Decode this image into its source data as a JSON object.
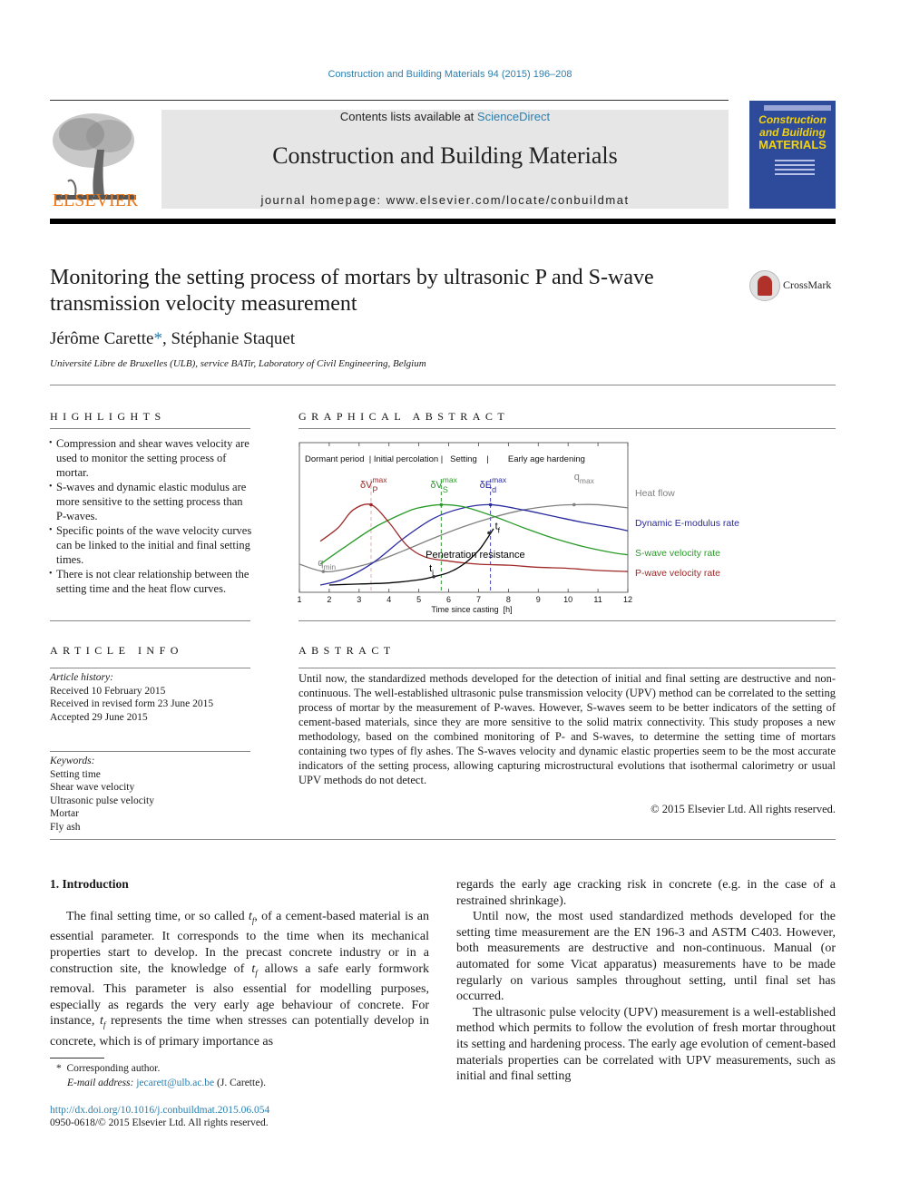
{
  "header": {
    "journal_reference": "Construction and Building Materials 94 (2015) 196–208",
    "contents_prefix": "Contents lists available at ",
    "contents_link": "ScienceDirect",
    "journal_title": "Construction and Building Materials",
    "homepage": "journal homepage: www.elsevier.com/locate/conbuildmat",
    "publisher_logo_text": "ELSEVIER",
    "cover": {
      "line1": "Construction",
      "line2": "and Building",
      "line3": "MATERIALS"
    }
  },
  "article": {
    "title": "Monitoring the setting process of mortars by ultrasonic P and S-wave transmission velocity measurement",
    "crossmark_label": "CrossMark",
    "authors": [
      {
        "name": "Jérôme Carette",
        "mark": "*"
      },
      {
        "name": "Stéphanie Staquet",
        "mark": ""
      }
    ],
    "author_separator": ", ",
    "affiliation": "Université Libre de Bruxelles (ULB), service BATir, Laboratory of Civil Engineering, Belgium"
  },
  "highlights": {
    "heading": "HIGHLIGHTS",
    "items": [
      "Compression and shear waves velocity are used to monitor the setting process of mortar.",
      "S-waves and dynamic elastic modulus are more sensitive to the setting process than P-waves.",
      "Specific points of the wave velocity curves can be linked to the initial and final setting times.",
      "There is not clear relationship between the setting time and the heat flow curves."
    ]
  },
  "graphical_abstract": {
    "heading": "GRAPHICAL ABSTRACT"
  },
  "article_info": {
    "heading": "ARTICLE INFO",
    "history_label": "Article history:",
    "history": [
      "Received 10 February 2015",
      "Received in revised form 23 June 2015",
      "Accepted 29 June 2015"
    ],
    "keywords_label": "Keywords:",
    "keywords": [
      "Setting time",
      "Shear wave velocity",
      "Ultrasonic pulse velocity",
      "Mortar",
      "Fly ash"
    ]
  },
  "abstract": {
    "heading": "ABSTRACT",
    "text": "Until now, the standardized methods developed for the detection of initial and final setting are destructive and non-continuous. The well-established ultrasonic pulse transmission velocity (UPV) method can be correlated to the setting process of mortar by the measurement of P-waves. However, S-waves seem to be better indicators of the setting of cement-based materials, since they are more sensitive to the solid matrix connectivity. This study proposes a new methodology, based on the combined monitoring of P- and S-waves, to determine the setting time of mortars containing two types of fly ashes. The S-waves velocity and dynamic elastic properties seem to be the most accurate indicators of the setting process, allowing capturing microstructural evolutions that isothermal calorimetry or usual UPV methods do not detect.",
    "copyright": "© 2015 Elsevier Ltd. All rights reserved."
  },
  "introduction": {
    "heading": "1. Introduction",
    "col1_p1_parts": [
      "The final setting time, or so called ",
      "t",
      "f",
      ", of a cement-based material is an essential parameter. It corresponds to the time when its mechanical properties start to develop. In the precast concrete industry or in a construction site, the knowledge of ",
      "t",
      "f",
      " allows a safe early formwork removal. This parameter is also essential for modelling purposes, especially as regards the very early age behaviour of concrete. For instance, ",
      "t",
      "f",
      " represents the time when stresses can potentially develop in concrete, which is of primary importance as"
    ],
    "col2_p0": "regards the early age cracking risk in concrete (e.g. in the case of a restrained shrinkage).",
    "col2_p1": "Until now, the most used standardized methods developed for the setting time measurement are the EN 196-3 and ASTM C403. However, both measurements are destructive and non-continuous. Manual (or automated for some Vicat apparatus) measurements have to be made regularly on various samples throughout setting, until final set has occurred.",
    "col2_p2": "The ultrasonic pulse velocity (UPV) measurement is a well-established method which permits to follow the evolution of fresh mortar throughout its setting and hardening process. The early age evolution of cement-based materials properties can be correlated with UPV measurements, such as initial and final setting"
  },
  "footnotes": {
    "corresponding_mark": "*",
    "corresponding": "Corresponding author.",
    "email_label": "E-mail address: ",
    "email": "jecarett@ulb.ac.be",
    "email_suffix": " (J. Carette).",
    "doi": "http://dx.doi.org/10.1016/j.conbuildmat.2015.06.054",
    "issn_line": "0950-0618/© 2015 Elsevier Ltd. All rights reserved."
  },
  "chart_data": {
    "type": "line",
    "title": "",
    "xlabel": "Time since casting  [h]",
    "ylabel": "",
    "xlim": [
      1,
      12
    ],
    "ylim": [
      0,
      1
    ],
    "x_ticks": [
      1,
      2,
      3,
      4,
      5,
      6,
      7,
      8,
      9,
      10,
      11,
      12
    ],
    "grid": false,
    "legend_placement": "right",
    "phase_labels": "Dormant period  | Initial percolation |   Setting    |        Early age hardening",
    "series": [
      {
        "name": "Heat flow",
        "color": "#808080",
        "x": [
          1.0,
          1.8,
          2.5,
          3.5,
          4.5,
          5.5,
          6.5,
          7.5,
          8.5,
          9.5,
          10.2,
          11.0,
          12.0
        ],
        "y": [
          0.2,
          0.13,
          0.15,
          0.22,
          0.33,
          0.45,
          0.56,
          0.65,
          0.72,
          0.76,
          0.77,
          0.77,
          0.74
        ]
      },
      {
        "name": "Dynamic E-modulus rate",
        "color": "#2a2aa0",
        "x": [
          1.7,
          2.5,
          3.5,
          4.5,
          5.5,
          6.5,
          7.4,
          8.5,
          9.5,
          10.5,
          11.5,
          12.0
        ],
        "y": [
          0.0,
          0.06,
          0.22,
          0.45,
          0.64,
          0.74,
          0.77,
          0.72,
          0.66,
          0.6,
          0.55,
          0.52
        ]
      },
      {
        "name": "S-wave velocity rate",
        "color": "#2a9a2a",
        "x": [
          1.7,
          2.5,
          3.5,
          4.5,
          5.0,
          5.75,
          6.5,
          7.5,
          8.5,
          9.5,
          10.5,
          11.5,
          12.0
        ],
        "y": [
          0.2,
          0.36,
          0.55,
          0.69,
          0.74,
          0.77,
          0.75,
          0.66,
          0.55,
          0.45,
          0.37,
          0.31,
          0.29
        ]
      },
      {
        "name": "P-wave velocity rate",
        "color": "#a02828",
        "x": [
          1.7,
          2.3,
          2.8,
          3.4,
          4.0,
          4.6,
          5.2,
          6.0,
          7.0,
          8.0,
          9.0,
          10.0,
          11.0,
          12.0
        ],
        "y": [
          0.42,
          0.55,
          0.72,
          0.77,
          0.6,
          0.38,
          0.27,
          0.23,
          0.2,
          0.19,
          0.17,
          0.16,
          0.14,
          0.13
        ]
      },
      {
        "name": "Penetration resistance",
        "color": "#000000",
        "x": [
          2.0,
          3.0,
          4.0,
          5.0,
          5.5,
          6.0,
          6.5,
          7.0,
          7.3,
          7.5
        ],
        "y": [
          0.0,
          0.01,
          0.02,
          0.05,
          0.08,
          0.12,
          0.2,
          0.33,
          0.45,
          0.54
        ]
      }
    ],
    "annotations": [
      {
        "label": "δV",
        "sup": "max",
        "sub": "P",
        "x": 3.4,
        "color": "#a02828"
      },
      {
        "label": "δV",
        "sup": "max",
        "sub": "S",
        "x": 5.75,
        "color": "#2a9a2a"
      },
      {
        "label": "δE",
        "sup": "max",
        "sub": "d",
        "x": 7.4,
        "color": "#2a2aa0"
      },
      {
        "label": "q",
        "sub": "max",
        "x": 10.2,
        "color": "#808080"
      },
      {
        "label": "q",
        "sub": "min",
        "x": 1.8,
        "color": "#808080"
      },
      {
        "label": "t",
        "sub": "i",
        "x": 5.5,
        "color": "#000000"
      },
      {
        "label": "t",
        "sub": "f",
        "x": 7.4,
        "color": "#000000"
      },
      {
        "label": "Penetration resistance",
        "x": 6.9,
        "color": "#000000"
      }
    ],
    "vertical_markers": [
      {
        "x": 3.4,
        "color": "#e0b0b0"
      },
      {
        "x": 5.75,
        "color": "#2a9a2a"
      },
      {
        "x": 7.4,
        "color": "#4a4ab0"
      }
    ]
  }
}
